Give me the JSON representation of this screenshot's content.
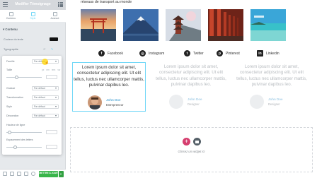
{
  "panel": {
    "title": "Modifier Témoignage",
    "tabs": [
      {
        "label": "Contenu"
      },
      {
        "label": "Style"
      },
      {
        "label": "Avancé"
      }
    ],
    "section_title": "Contenu",
    "text_color_label": "Couleur du texte",
    "text_color_value": "#111111",
    "typography_label": "Typographie",
    "typography_popup": {
      "family_label": "Famille",
      "family_value": "Par défaut",
      "size_label": "Taille",
      "size_units": [
        "px",
        "em",
        "rem",
        "vw"
      ],
      "weight_label": "Graisse",
      "weight_value": "Par défaut",
      "transform_label": "Transformation",
      "transform_value": "Par défaut",
      "style_label": "Style",
      "style_value": "Par défaut",
      "decoration_label": "Décoration",
      "decoration_value": "Par défaut",
      "line_height_label": "Hauteur de ligne",
      "letter_spacing_label": "Espacement des lettres"
    },
    "publish_label": "METTRE À JOUR"
  },
  "canvas": {
    "section_heading": "réseaux de transport au monde",
    "photos": [
      {
        "name": "photo-torii-gate",
        "sky": "#e8a36a",
        "water": "#30465e"
      },
      {
        "name": "photo-mount-fuji",
        "sky": "#3e6fae",
        "water": "#2a4c7a"
      },
      {
        "name": "photo-pagoda",
        "sky": "#d7dde6",
        "water": "#4f5f6a"
      },
      {
        "name": "photo-red-gates",
        "sky": "#b34a2f",
        "water": "#6e2318"
      },
      {
        "name": "photo-lagoon",
        "sky": "#3aa6d8",
        "water": "#38c1c9"
      }
    ],
    "social": [
      {
        "icon": "facebook-icon",
        "glyph": "f",
        "label": "Facebook"
      },
      {
        "icon": "instagram-icon",
        "glyph": "◎",
        "label": "Instagram"
      },
      {
        "icon": "twitter-icon",
        "glyph": "t",
        "label": "Twitter"
      },
      {
        "icon": "pinterest-icon",
        "glyph": "p",
        "label": "Pinterest"
      },
      {
        "icon": "linkedin-icon",
        "glyph": "in",
        "label": "Linkedin"
      }
    ],
    "testimonials": [
      {
        "text": "Lorem ipsum dolor sit amet, consectetur adipiscing elit. Ut elit tellus, luctus nec ullamcorper mattis, pulvinar dapibus leo.",
        "name": "John Doe",
        "role": "Entrepreneur"
      },
      {
        "text": "Lorem ipsum dolor sit amet, consectetur adipiscing elit. Ut elit tellus, luctus nec ullamcorper mattis, pulvinar dapibus leo.",
        "name": "John Doe",
        "role": "Designer"
      },
      {
        "text": "Lorem ipsum dolor sit amet, consectetur adipiscing elit. Ut elit tellus, luctus nec ullamcorper mattis, pulvinar dapibus leo.",
        "name": "John Doe",
        "role": "Designer"
      }
    ],
    "drop_zone_label": "Glissez un widget ici"
  },
  "colors": {
    "accent_pink": "#d63f6f",
    "selection_blue": "#71d7f7",
    "publish_green": "#39b54a",
    "name_blue": "#5cacd8"
  }
}
